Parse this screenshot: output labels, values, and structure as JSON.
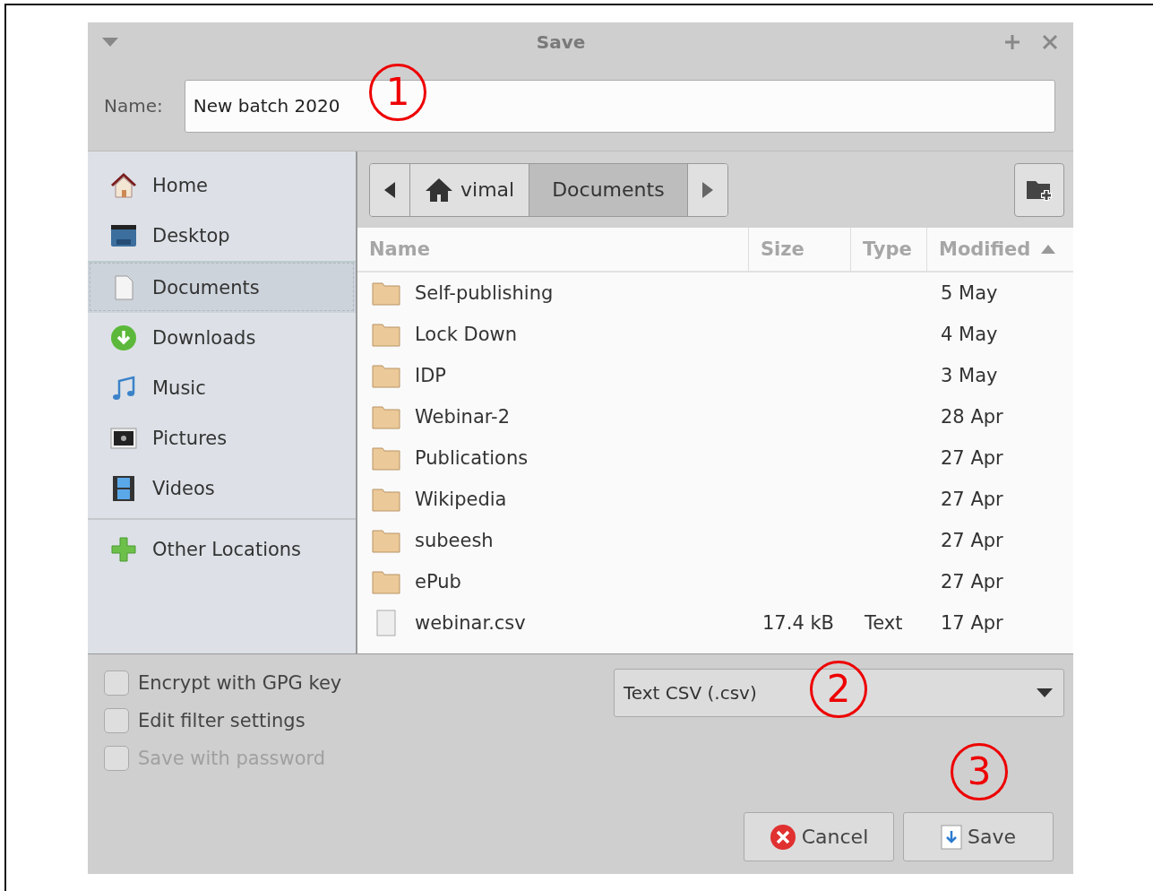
{
  "window": {
    "title": "Save"
  },
  "name_field": {
    "label": "Name:",
    "value": "New batch 2020"
  },
  "sidebar": {
    "groups": [
      [
        {
          "label": "Home",
          "kind": "home",
          "selected": false
        },
        {
          "label": "Desktop",
          "kind": "desktop",
          "selected": false
        },
        {
          "label": "Documents",
          "kind": "document",
          "selected": true
        },
        {
          "label": "Downloads",
          "kind": "download",
          "selected": false
        },
        {
          "label": "Music",
          "kind": "music",
          "selected": false
        },
        {
          "label": "Pictures",
          "kind": "pictures",
          "selected": false
        },
        {
          "label": "Videos",
          "kind": "videos",
          "selected": false
        }
      ],
      [
        {
          "label": "Other Locations",
          "kind": "add",
          "selected": false
        }
      ]
    ]
  },
  "path_bar": [
    {
      "label": "vimal",
      "kind": "home",
      "selected": false
    },
    {
      "label": "Documents",
      "kind": "folder",
      "selected": true
    }
  ],
  "table": {
    "columns": [
      {
        "label": "Name",
        "sorted": false
      },
      {
        "label": "Size",
        "sorted": false
      },
      {
        "label": "Type",
        "sorted": false
      },
      {
        "label": "Modified",
        "sorted": true
      }
    ],
    "rows": [
      {
        "kind": "folder",
        "name": "Self-publishing",
        "modified": "5 May"
      },
      {
        "kind": "folder",
        "name": "Lock Down",
        "modified": "4 May"
      },
      {
        "kind": "folder",
        "name": "IDP",
        "modified": "3 May"
      },
      {
        "kind": "folder",
        "name": "Webinar-2",
        "modified": "28 Apr"
      },
      {
        "kind": "folder",
        "name": "Publications",
        "modified": "27 Apr"
      },
      {
        "kind": "folder",
        "name": "Wikipedia",
        "modified": "27 Apr"
      },
      {
        "kind": "folder",
        "name": "subeesh",
        "modified": "27 Apr"
      },
      {
        "kind": "folder",
        "name": "ePub",
        "modified": "27 Apr"
      },
      {
        "kind": "file",
        "name": "webinar.csv",
        "size": "17.4 kB",
        "type": "Text",
        "modified": "17 Apr"
      }
    ]
  },
  "options": [
    {
      "label": "Encrypt with GPG key",
      "checked": false,
      "disabled": false
    },
    {
      "label": "Edit filter settings",
      "checked": false,
      "disabled": false
    },
    {
      "label": "Save with password",
      "checked": false,
      "disabled": true
    }
  ],
  "file_type": {
    "value": "Text CSV (.csv)"
  },
  "buttons": [
    {
      "kind": "cancel",
      "label": "Cancel"
    },
    {
      "kind": "save",
      "label": "Save"
    }
  ],
  "annotations": [
    "1",
    "2",
    "3"
  ]
}
